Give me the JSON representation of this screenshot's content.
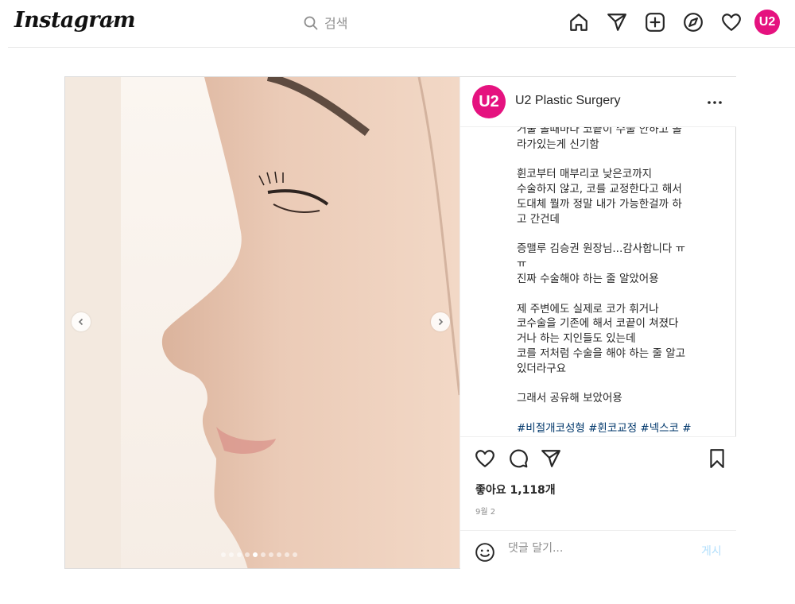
{
  "header": {
    "logo": "Instagram",
    "search_placeholder": "검색",
    "nav_icons": [
      "home-icon",
      "direct-message-icon",
      "new-post-icon",
      "explore-icon",
      "activity-heart-icon",
      "profile-avatar"
    ],
    "profile_avatar_text": "U2"
  },
  "post": {
    "account": {
      "avatar_text": "U2",
      "username": "U2 Plastic Surgery"
    },
    "caption_paragraphs": [
      "거울 볼때마다 코끝이 수술 안하고 올\n라가있는게 신기함",
      "휜코부터 매부리코 낮은코까지\n수술하지 않고, 코를 교정한다고 해서\n도대체 뭘까 정말 내가 가능한걸까 하\n고 간건데",
      "증맬루 김승권 원장님...감사합니다 ㅠ\nㅠ\n진짜 수술해야 하는 줄 알았어용",
      "제 주변에도 실제로 코가 휘거나\n코수술을 기존에 해서 코끝이 쳐졌다\n거나 하는 지인들도 있는데\n코를 저처럼 수술을 해야 하는 줄 알고\n있더라구요",
      "그래서 공유해 보았어용"
    ],
    "hashtags": "#비절개코성형 #휜코교정 #넥스코 #",
    "likes": "좋아요 1,118개",
    "date": "9월 2",
    "comment_placeholder": "댓글 달기...",
    "post_button": "게시",
    "carousel": {
      "slide_count": 10,
      "active_index": 4
    }
  },
  "colors": {
    "brand_pink": "#e5127f",
    "hashtag": "#00376b",
    "post_button_disabled": "#b2dffc",
    "border": "#dbdbdb"
  }
}
